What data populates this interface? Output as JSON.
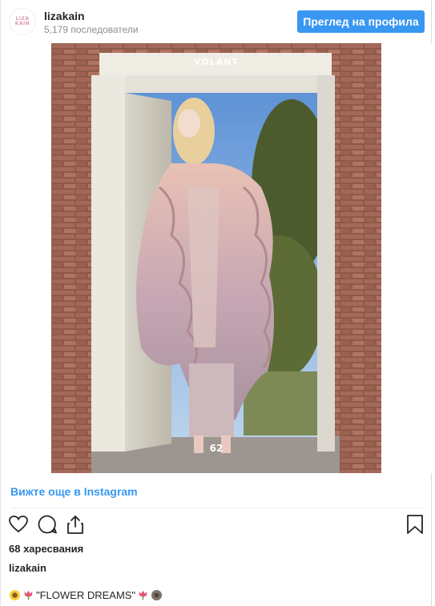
{
  "header": {
    "avatar_text_top": "LIZA",
    "avatar_text_bottom": "KAIN",
    "username": "lizakain",
    "followers": "5,179 последователи",
    "profile_button": "Преглед на профила"
  },
  "photo": {
    "magazine_title": "VOLANT",
    "page_number": "62"
  },
  "links": {
    "view_more": "Вижте още в Instagram"
  },
  "actions": {
    "icons": [
      "heart-icon",
      "comment-icon",
      "share-icon",
      "bookmark-icon"
    ]
  },
  "likes": "68 харесвания",
  "caption": {
    "username": "lizakain",
    "text": "\"FLOWER DREAMS\""
  },
  "colors": {
    "accent": "#3897f0",
    "text": "#262626",
    "muted": "#8e8e8e"
  }
}
